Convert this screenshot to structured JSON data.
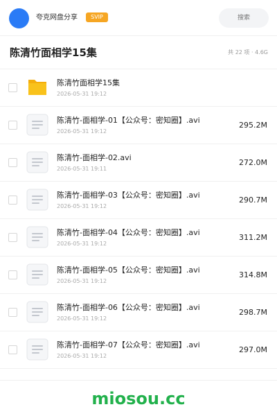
{
  "header": {
    "share_name": "夸克网盘分享",
    "badge": "SVIP",
    "search_placeholder": "搜索"
  },
  "title_bar": {
    "title": "陈清竹面相学15集",
    "summary": "共 22 项 · 4.6G"
  },
  "files": [
    {
      "type": "folder",
      "name": "陈清竹面相学15集",
      "date": "2026-05-31 19:12",
      "size": ""
    },
    {
      "type": "file",
      "name": "陈清竹-面相学-01【公众号：密知圈】.avi",
      "date": "2026-05-31 19:12",
      "size": "295.2M"
    },
    {
      "type": "file",
      "name": "陈清竹-面相学-02.avi",
      "date": "2026-05-31 19:11",
      "size": "272.0M"
    },
    {
      "type": "file",
      "name": "陈清竹-面相学-03【公众号：密知圈】.avi",
      "date": "2026-05-31 19:12",
      "size": "290.7M"
    },
    {
      "type": "file",
      "name": "陈清竹-面相学-04【公众号：密知圈】.avi",
      "date": "2026-05-31 19:12",
      "size": "311.2M"
    },
    {
      "type": "file",
      "name": "陈清竹-面相学-05【公众号：密知圈】.avi",
      "date": "2026-05-31 19:12",
      "size": "314.8M"
    },
    {
      "type": "file",
      "name": "陈清竹-面相学-06【公众号：密知圈】.avi",
      "date": "2026-05-31 19:12",
      "size": "298.7M"
    },
    {
      "type": "file",
      "name": "陈清竹-面相学-07【公众号：密知圈】.avi",
      "date": "2026-05-31 19:12",
      "size": "297.0M"
    }
  ],
  "icons": {
    "folder": "folder-icon",
    "file": "document-icon"
  },
  "colors": {
    "avatar": "#2a7bf6",
    "badge": "#f6a623",
    "folder": "#f9c21b",
    "watermark": "#22b14c"
  },
  "footer": {
    "watermark": "miosou.cc"
  }
}
